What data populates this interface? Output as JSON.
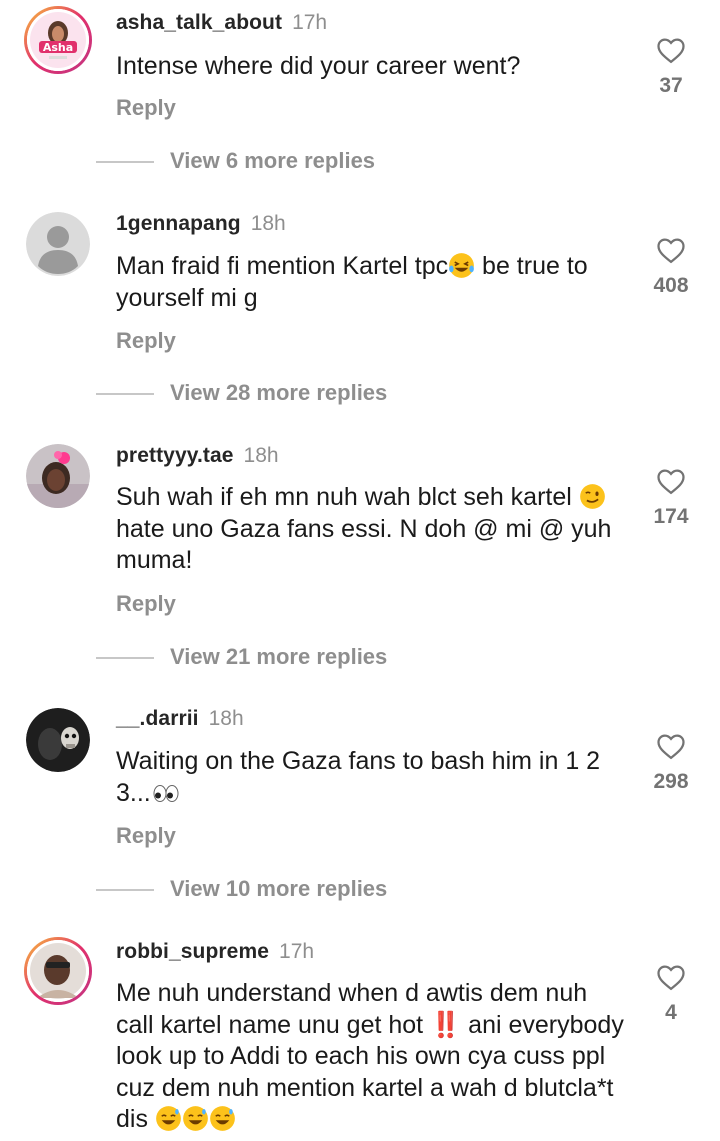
{
  "comments": [
    {
      "username": "asha_talk_about",
      "time": "17h",
      "text": "Intense where did your career went?",
      "reply_label": "Reply",
      "likes": "37",
      "view_replies": "View 6 more replies",
      "avatar_text": "Asha"
    },
    {
      "username": "1gennapang",
      "time": "18h",
      "text_a": "Man fraid fi mention Kartel tpc",
      "text_b": " be true to yourself mi g",
      "reply_label": "Reply",
      "likes": "408",
      "view_replies": "View 28 more replies"
    },
    {
      "username": "prettyyy.tae",
      "time": "18h",
      "text_a": "Suh wah if eh mn nuh wah blct seh kartel ",
      "text_b": " hate uno Gaza fans essi. N doh @ mi @ yuh muma!",
      "reply_label": "Reply",
      "likes": "174",
      "view_replies": "View 21 more replies"
    },
    {
      "username": "__.darrii",
      "time": "18h",
      "text_a": "Waiting on the Gaza fans to bash him  in 1 2 3...",
      "reply_label": "Reply",
      "likes": "298",
      "view_replies": "View 10 more replies"
    },
    {
      "username": "robbi_supreme",
      "time": "17h",
      "text_a": "Me nuh understand when d awtis dem nuh call kartel name unu get hot ",
      "text_bang": "‼️",
      "text_b": " ani everybody look up to Addi to each his own cya cuss ppl cuz dem nuh mention kartel a wah d blutcla*t dis ",
      "likes": "4"
    }
  ],
  "icons": {
    "like": "heart-outline-icon",
    "default_avatar": "person-silhouette-icon"
  },
  "colors": {
    "text": "#1a1a1a",
    "secondary": "#8e8e8e",
    "story_ring": [
      "#f9c33b",
      "#e1306c",
      "#c13584"
    ]
  }
}
